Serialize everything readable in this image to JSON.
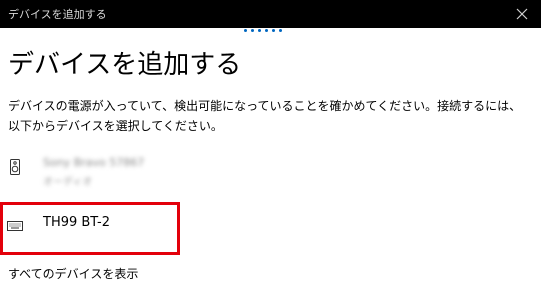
{
  "window": {
    "title": "デバイスを追加する"
  },
  "main": {
    "heading": "デバイスを追加する",
    "description": "デバイスの電源が入っていて、検出可能になっていることを確かめてください。接続するには、以下からデバイスを選択してください。"
  },
  "devices": [
    {
      "name": "Sony Bravo 57867",
      "status": "オーディオ",
      "icon": "speaker-icon",
      "obscured": true
    },
    {
      "name": "TH99 BT-2",
      "icon": "keyboard-icon",
      "highlighted": true
    }
  ],
  "footer": {
    "show_all_label": "すべてのデバイスを表示"
  },
  "colors": {
    "titlebar": "#000000",
    "accent": "#0067c0",
    "highlight": "#e3000b"
  }
}
